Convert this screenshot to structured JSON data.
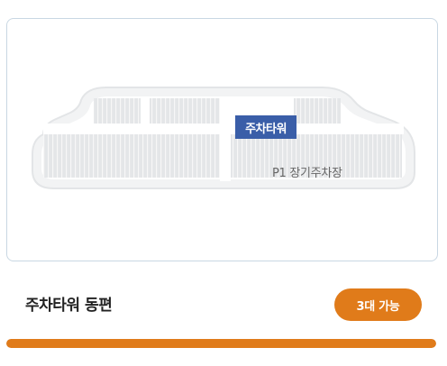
{
  "map": {
    "tower_label": "주차타워",
    "lot_label": "P1 장기주차장"
  },
  "lot": {
    "title": "주차타워 동편",
    "availability": "3대 가능",
    "occupancy_fraction": 1.0
  },
  "colors": {
    "accent": "#e07b1a",
    "tower_badge": "#3a5ea8",
    "card_border": "#c9d7e3"
  }
}
